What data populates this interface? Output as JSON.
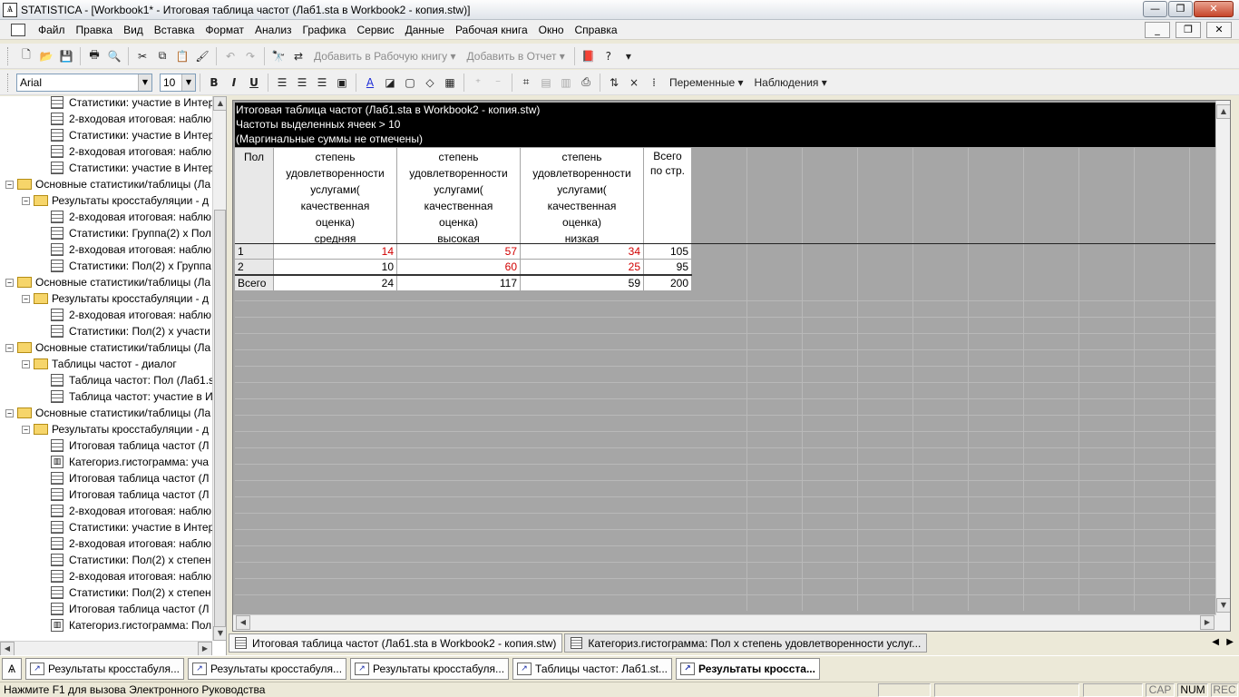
{
  "window": {
    "title": "STATISTICA - [Workbook1* - Итоговая таблица частот (Лаб1.sta в Workbook2 - копия.stw)]",
    "app_icon": "statistica-icon",
    "min": "—",
    "max": "❐",
    "close": "✕"
  },
  "menu": {
    "items": [
      "Файл",
      "Правка",
      "Вид",
      "Вставка",
      "Формат",
      "Анализ",
      "Графика",
      "Сервис",
      "Данные",
      "Рабочая книга",
      "Окно",
      "Справка"
    ],
    "mdi_min": "_",
    "mdi_restore": "❐",
    "mdi_close": "✕"
  },
  "toolbar1": {
    "add_workbook": "Добавить в Рабочую книгу ▾",
    "add_report": "Добавить в Отчет ▾"
  },
  "toolbar2": {
    "font": "Arial",
    "size": "10",
    "bold": "B",
    "italic": "I",
    "underline": "U",
    "variables": "Переменные ▾",
    "observations": "Наблюдения ▾"
  },
  "tree": [
    {
      "level": 3,
      "icon": "doc",
      "label": "Статистики: участие в Интер"
    },
    {
      "level": 3,
      "icon": "doc",
      "label": "2-входовая итоговая: наблю"
    },
    {
      "level": 3,
      "icon": "doc",
      "label": "Статистики: участие в Интер"
    },
    {
      "level": 3,
      "icon": "doc",
      "label": "2-входовая итоговая: наблю"
    },
    {
      "level": 3,
      "icon": "doc",
      "label": "Статистики: участие в Интер"
    },
    {
      "level": 1,
      "icon": "folder",
      "label": "Основные статистики/таблицы (Ла"
    },
    {
      "level": 2,
      "icon": "folder",
      "label": "Результаты кросстабуляции - д"
    },
    {
      "level": 3,
      "icon": "doc",
      "label": "2-входовая итоговая: наблю"
    },
    {
      "level": 3,
      "icon": "doc",
      "label": "Статистики: Группа(2) х Пол"
    },
    {
      "level": 3,
      "icon": "doc",
      "label": "2-входовая итоговая: наблю"
    },
    {
      "level": 3,
      "icon": "doc",
      "label": "Статистики: Пол(2) х Группа"
    },
    {
      "level": 1,
      "icon": "folder",
      "label": "Основные статистики/таблицы (Ла"
    },
    {
      "level": 2,
      "icon": "folder",
      "label": "Результаты кросстабуляции - д"
    },
    {
      "level": 3,
      "icon": "doc",
      "label": "2-входовая итоговая: наблю"
    },
    {
      "level": 3,
      "icon": "doc",
      "label": "Статистики: Пол(2) х участи"
    },
    {
      "level": 1,
      "icon": "folder",
      "label": "Основные статистики/таблицы (Ла"
    },
    {
      "level": 2,
      "icon": "folder",
      "label": "Таблицы частот - диалог"
    },
    {
      "level": 3,
      "icon": "doc",
      "label": "Таблица частот: Пол (Лаб1.s"
    },
    {
      "level": 3,
      "icon": "doc",
      "label": "Таблица частот: участие в И"
    },
    {
      "level": 1,
      "icon": "folder",
      "label": "Основные статистики/таблицы (Ла"
    },
    {
      "level": 2,
      "icon": "folder",
      "label": "Результаты кросстабуляции - д"
    },
    {
      "level": 3,
      "icon": "doc",
      "label": "Итоговая таблица частот (Л"
    },
    {
      "level": 3,
      "icon": "chart",
      "label": "Категориз.гистограмма: уча"
    },
    {
      "level": 3,
      "icon": "doc",
      "label": "Итоговая таблица частот (Л"
    },
    {
      "level": 3,
      "icon": "doc",
      "label": "Итоговая таблица частот (Л"
    },
    {
      "level": 3,
      "icon": "doc",
      "label": "2-входовая итоговая: наблю"
    },
    {
      "level": 3,
      "icon": "doc",
      "label": "Статистики: участие в Интер"
    },
    {
      "level": 3,
      "icon": "doc",
      "label": "2-входовая итоговая: наблю"
    },
    {
      "level": 3,
      "icon": "doc",
      "label": "Статистики: Пол(2) х степен"
    },
    {
      "level": 3,
      "icon": "doc",
      "label": "2-входовая итоговая: наблю"
    },
    {
      "level": 3,
      "icon": "doc",
      "label": "Статистики: Пол(2) х степен"
    },
    {
      "level": 3,
      "icon": "doc",
      "label": "Итоговая таблица частот (Л"
    },
    {
      "level": 3,
      "icon": "chart",
      "label": "Категориз.гистограмма: Пол"
    }
  ],
  "sheet": {
    "header_lines": [
      "Итоговая таблица частот (Лаб1.sta в Workbook2 - копия.stw)",
      "Частоты выделенных ячеек > 10",
      "(Маргинальные суммы не отмечены)"
    ],
    "columns": [
      {
        "lines": [
          "Пол"
        ]
      },
      {
        "lines": [
          "степень",
          "удовлетворенности",
          "услугами(",
          "качественная",
          "оценка)",
          "средняя"
        ]
      },
      {
        "lines": [
          "степень",
          "удовлетворенности",
          "услугами(",
          "качественная",
          "оценка)",
          "высокая"
        ]
      },
      {
        "lines": [
          "степень",
          "удовлетворенности",
          "услугами(",
          "качественная",
          "оценка)",
          "низкая"
        ]
      },
      {
        "lines": [
          "Всего",
          "по стр."
        ]
      }
    ],
    "rows": [
      {
        "label": "1",
        "values": [
          "14",
          "57",
          "34",
          "105"
        ],
        "red": [
          true,
          true,
          true,
          false
        ]
      },
      {
        "label": "2",
        "values": [
          "10",
          "60",
          "25",
          "95"
        ],
        "red": [
          false,
          true,
          true,
          false
        ]
      },
      {
        "label": "Всего",
        "values": [
          "24",
          "117",
          "59",
          "200"
        ],
        "red": [
          false,
          false,
          false,
          false
        ]
      }
    ]
  },
  "workbook_tabs": [
    "Итоговая таблица частот (Лаб1.sta в Workbook2 - копия.stw)",
    "Категориз.гистограмма: Пол х степень  удовлетворенности услуг..."
  ],
  "taskbar": [
    {
      "label": "Результаты кросстабуля...",
      "active": false
    },
    {
      "label": "Результаты кросстабуля...",
      "active": false
    },
    {
      "label": "Результаты кросстабуля...",
      "active": false
    },
    {
      "label": "Таблицы частот: Лаб1.st...",
      "active": false
    },
    {
      "label": "Результаты кросста...",
      "active": true
    }
  ],
  "status": {
    "text": "Нажмите F1 для вызова Электронного Руководства",
    "cap": "CAP",
    "num": "NUM",
    "rec": "REC"
  }
}
